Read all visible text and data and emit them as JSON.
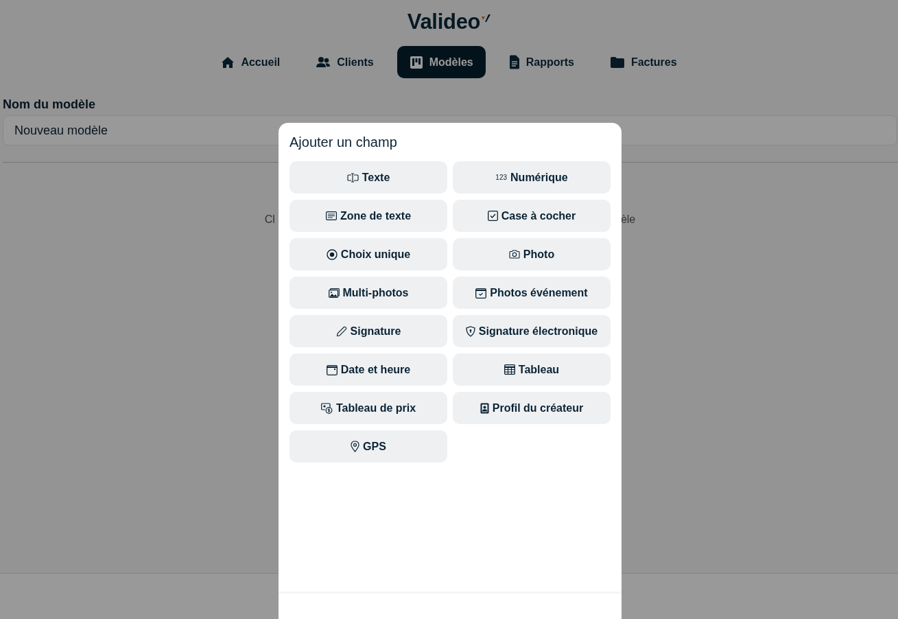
{
  "logo": "Valideo",
  "nav": [
    {
      "label": "Accueil",
      "kind": "home",
      "selected": false
    },
    {
      "label": "Clients",
      "kind": "users",
      "selected": false
    },
    {
      "label": "Modèles",
      "kind": "board",
      "selected": true
    },
    {
      "label": "Rapports",
      "kind": "document",
      "selected": false
    },
    {
      "label": "Factures",
      "kind": "folder",
      "selected": false
    }
  ],
  "model_name": {
    "label": "Nom du modèle",
    "value": "Nouveau modèle"
  },
  "empty_hint": {
    "left_part": "Cl",
    "right_part": "èle"
  },
  "dialog": {
    "title": "Ajouter un champ",
    "fields": [
      {
        "label": "Texte",
        "kind": "text"
      },
      {
        "label": "Numérique",
        "kind": "number",
        "icon_text": "123"
      },
      {
        "label": "Zone de texte",
        "kind": "textarea"
      },
      {
        "label": "Case à cocher",
        "kind": "checkbox"
      },
      {
        "label": "Choix unique",
        "kind": "radio"
      },
      {
        "label": "Photo",
        "kind": "photo"
      },
      {
        "label": "Multi-photos",
        "kind": "multiphoto"
      },
      {
        "label": "Photos événement",
        "kind": "eventphoto"
      },
      {
        "label": "Signature",
        "kind": "signature"
      },
      {
        "label": "Signature électronique",
        "kind": "esignature"
      },
      {
        "label": "Date et heure",
        "kind": "datetime"
      },
      {
        "label": "Tableau",
        "kind": "table"
      },
      {
        "label": "Tableau de prix",
        "kind": "pricetable"
      },
      {
        "label": "Profil du créateur",
        "kind": "profile"
      },
      {
        "label": "GPS",
        "kind": "gps"
      }
    ]
  }
}
